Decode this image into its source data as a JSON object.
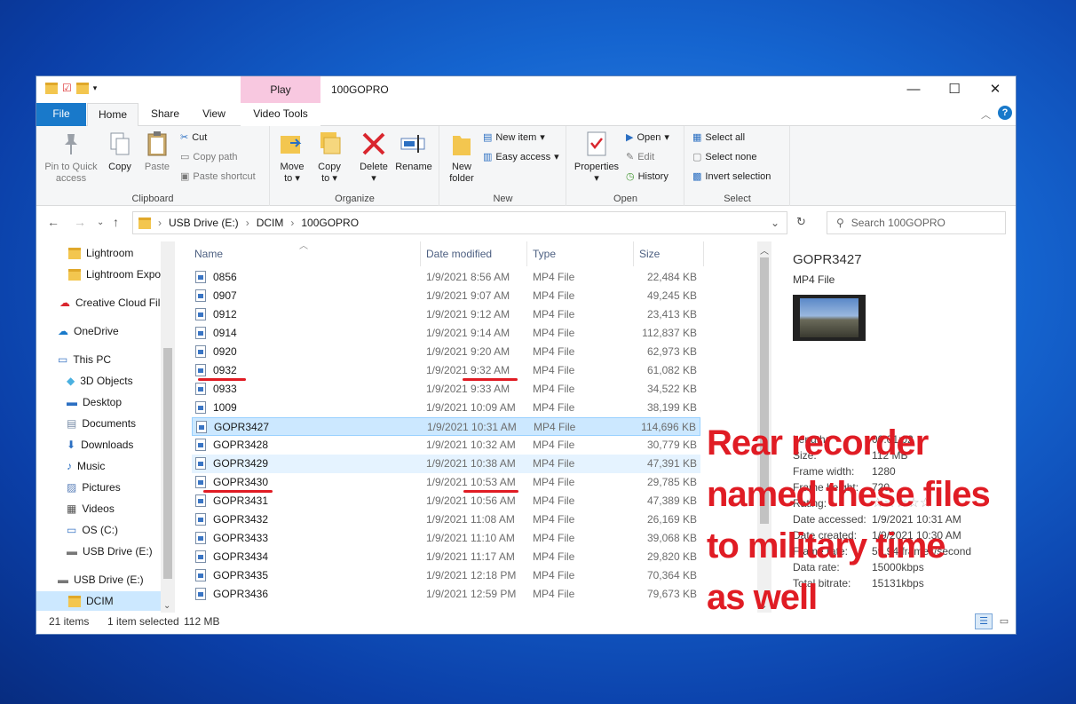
{
  "window": {
    "title": "100GOPRO",
    "context_tab": "Play"
  },
  "tabs": {
    "file": "File",
    "home": "Home",
    "share": "Share",
    "view": "View",
    "video_tools": "Video Tools"
  },
  "ribbon": {
    "clipboard": {
      "label": "Clipboard",
      "pin": "Pin to Quick",
      "pin2": "access",
      "copy": "Copy",
      "paste": "Paste",
      "cut": "Cut",
      "copy_path": "Copy path",
      "paste_shortcut": "Paste shortcut"
    },
    "organize": {
      "label": "Organize",
      "move": "Move",
      "move2": "to",
      "copy": "Copy",
      "copy2": "to",
      "delete": "Delete",
      "rename": "Rename"
    },
    "new": {
      "label": "New",
      "folder": "New",
      "folder2": "folder",
      "new_item": "New item",
      "easy_access": "Easy access"
    },
    "open": {
      "label": "Open",
      "properties": "Properties",
      "open": "Open",
      "edit": "Edit",
      "history": "History"
    },
    "select": {
      "label": "Select",
      "all": "Select all",
      "none": "Select none",
      "invert": "Invert selection"
    }
  },
  "address": {
    "crumbs": [
      "USB Drive (E:)",
      "DCIM",
      "100GOPRO"
    ],
    "search_placeholder": "Search 100GOPRO"
  },
  "sidebar": {
    "items": [
      "Lightroom",
      "Lightroom Expo",
      "Creative Cloud Fil",
      "OneDrive",
      "This PC",
      "3D Objects",
      "Desktop",
      "Documents",
      "Downloads",
      "Music",
      "Pictures",
      "Videos",
      "OS (C:)",
      "USB Drive (E:)",
      "USB Drive (E:)",
      "DCIM"
    ]
  },
  "columns": {
    "name": "Name",
    "date": "Date modified",
    "type": "Type",
    "size": "Size"
  },
  "files": [
    {
      "name": "0856",
      "date": "1/9/2021 8:56 AM",
      "type": "MP4 File",
      "size": "22,484 KB"
    },
    {
      "name": "0907",
      "date": "1/9/2021 9:07 AM",
      "type": "MP4 File",
      "size": "49,245 KB"
    },
    {
      "name": "0912",
      "date": "1/9/2021 9:12 AM",
      "type": "MP4 File",
      "size": "23,413 KB"
    },
    {
      "name": "0914",
      "date": "1/9/2021 9:14 AM",
      "type": "MP4 File",
      "size": "112,837 KB"
    },
    {
      "name": "0920",
      "date": "1/9/2021 9:20 AM",
      "type": "MP4 File",
      "size": "62,973 KB"
    },
    {
      "name": "0932",
      "date": "1/9/2021 9:32 AM",
      "type": "MP4 File",
      "size": "61,082 KB"
    },
    {
      "name": "0933",
      "date": "1/9/2021 9:33 AM",
      "type": "MP4 File",
      "size": "34,522 KB"
    },
    {
      "name": "1009",
      "date": "1/9/2021 10:09 AM",
      "type": "MP4 File",
      "size": "38,199 KB"
    },
    {
      "name": "GOPR3427",
      "date": "1/9/2021 10:31 AM",
      "type": "MP4 File",
      "size": "114,696 KB"
    },
    {
      "name": "GOPR3428",
      "date": "1/9/2021 10:32 AM",
      "type": "MP4 File",
      "size": "30,779 KB"
    },
    {
      "name": "GOPR3429",
      "date": "1/9/2021 10:38 AM",
      "type": "MP4 File",
      "size": "47,391 KB"
    },
    {
      "name": "GOPR3430",
      "date": "1/9/2021 10:53 AM",
      "type": "MP4 File",
      "size": "29,785 KB"
    },
    {
      "name": "GOPR3431",
      "date": "1/9/2021 10:56 AM",
      "type": "MP4 File",
      "size": "47,389 KB"
    },
    {
      "name": "GOPR3432",
      "date": "1/9/2021 11:08 AM",
      "type": "MP4 File",
      "size": "26,169 KB"
    },
    {
      "name": "GOPR3433",
      "date": "1/9/2021 11:10 AM",
      "type": "MP4 File",
      "size": "39,068 KB"
    },
    {
      "name": "GOPR3434",
      "date": "1/9/2021 11:17 AM",
      "type": "MP4 File",
      "size": "29,820 KB"
    },
    {
      "name": "GOPR3435",
      "date": "1/9/2021 12:18 PM",
      "type": "MP4 File",
      "size": "70,364 KB"
    },
    {
      "name": "GOPR3436",
      "date": "1/9/2021 12:59 PM",
      "type": "MP4 File",
      "size": "79,673 KB"
    }
  ],
  "preview": {
    "title": "GOPR3427",
    "subtitle": "MP4 File",
    "props": [
      {
        "label": "Length:",
        "value": "00:01:02"
      },
      {
        "label": "Size:",
        "value": "112 MB"
      },
      {
        "label": "Frame width:",
        "value": "1280"
      },
      {
        "label": "Frame height:",
        "value": "720"
      },
      {
        "label": "Rating:",
        "value": "☆☆☆☆☆"
      },
      {
        "label": "Date accessed:",
        "value": "1/9/2021 10:31 AM"
      },
      {
        "label": "Date created:",
        "value": "1/9/2021 10:30 AM"
      },
      {
        "label": "Frame rate:",
        "value": "59.94 frames/second"
      },
      {
        "label": "Data rate:",
        "value": "15000kbps"
      },
      {
        "label": "Total bitrate:",
        "value": "15131kbps"
      }
    ]
  },
  "status": {
    "count": "21 items",
    "selected": "1 item selected",
    "size": "112 MB"
  },
  "annotation": {
    "lines": [
      "Rear recorder",
      "named these files",
      "to military time",
      "as well"
    ],
    "color": "#e01c24"
  }
}
